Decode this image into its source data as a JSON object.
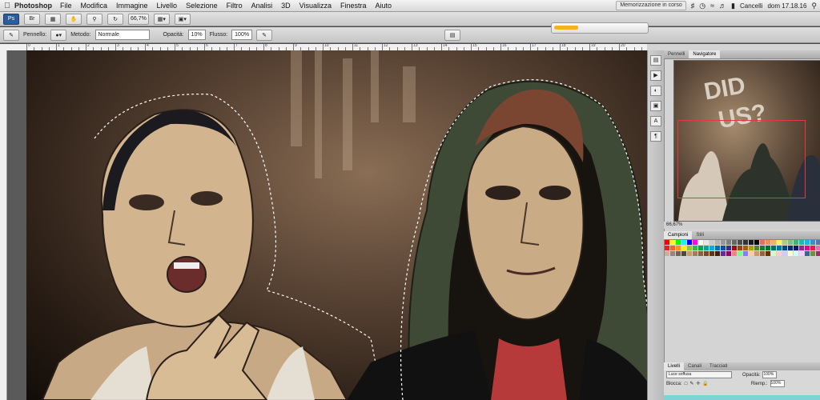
{
  "menubar": {
    "app_name": "Photoshop",
    "items": [
      "File",
      "Modifica",
      "Immagine",
      "Livello",
      "Selezione",
      "Filtro",
      "Analisi",
      "3D",
      "Visualizza",
      "Finestra",
      "Aiuto"
    ],
    "status_doc": "Memorizzazione in corso",
    "user": "Cancelli",
    "clock": "dom 17.18.16"
  },
  "appbar": {
    "zoom": "66,7%"
  },
  "options": {
    "brush_label": "Pennello:",
    "mode_label": "Metodo:",
    "mode_value": "Normale",
    "opacity_label": "Opacità:",
    "opacity_value": "10%",
    "flow_label": "Flusso:",
    "flow_value": "100%"
  },
  "progress": {
    "fraction": 0.25
  },
  "ruler_numbers": [
    "0",
    "1",
    "2",
    "3",
    "4",
    "5",
    "6",
    "7",
    "8",
    "9",
    "10",
    "11",
    "12",
    "13",
    "14",
    "15",
    "16",
    "17",
    "18",
    "19",
    "20",
    "21"
  ],
  "panels": {
    "nav_tabs": [
      "Pennelli",
      "Navigatore"
    ],
    "nav_active": "Navigatore",
    "nav_zoom": "66,67%",
    "swatch_tabs": [
      "Campioni",
      "Stili"
    ],
    "swatch_active": "Campioni",
    "layers_tabs": [
      "Livelli",
      "Canali",
      "Tracciati"
    ],
    "layers_active": "Livelli",
    "blend_mode": "Luce soffusa",
    "opacity_label": "Opacità:",
    "opacity_value": "100%",
    "fill_label": "Riemp.:",
    "fill_value": "100%",
    "lock_label": "Blocca:"
  },
  "swatch_colors": [
    "#ff0000",
    "#ffff00",
    "#00ff00",
    "#00ffff",
    "#0000ff",
    "#ff00ff",
    "#ffffff",
    "#e6e6e6",
    "#cccccc",
    "#b3b3b3",
    "#999999",
    "#808080",
    "#666666",
    "#4d4d4d",
    "#333333",
    "#1a1a1a",
    "#000000",
    "#f26c4f",
    "#f68e55",
    "#fbaf5c",
    "#fff467",
    "#acd372",
    "#7cc576",
    "#3bb878",
    "#1abbb4",
    "#00bff3",
    "#438cca",
    "#5574b9",
    "#ed1c24",
    "#f26522",
    "#f7941d",
    "#fff200",
    "#8dc63f",
    "#39b54a",
    "#00a651",
    "#00a99d",
    "#00aeef",
    "#0072bc",
    "#0054a6",
    "#2e3192",
    "#9e0b0f",
    "#a0410d",
    "#a36209",
    "#aba000",
    "#598527",
    "#197b30",
    "#007236",
    "#00746b",
    "#0076a3",
    "#004a80",
    "#003471",
    "#1b1464",
    "#92278f",
    "#ec008c",
    "#ed145b",
    "#f06eaa",
    "#c7b299",
    "#998675",
    "#736357",
    "#534741",
    "#c69c6d",
    "#a67c52",
    "#8c6239",
    "#754c24",
    "#603913",
    "#42210b",
    "#662d91",
    "#9e005d",
    "#ff8080",
    "#80ff80",
    "#8080ff",
    "#ffcc99",
    "#cc9966",
    "#996633",
    "#663300",
    "#ccffcc",
    "#ffcccc",
    "#ccccff",
    "#ffffcc",
    "#ccffff",
    "#ffccff",
    "#336699",
    "#669933",
    "#993366"
  ]
}
